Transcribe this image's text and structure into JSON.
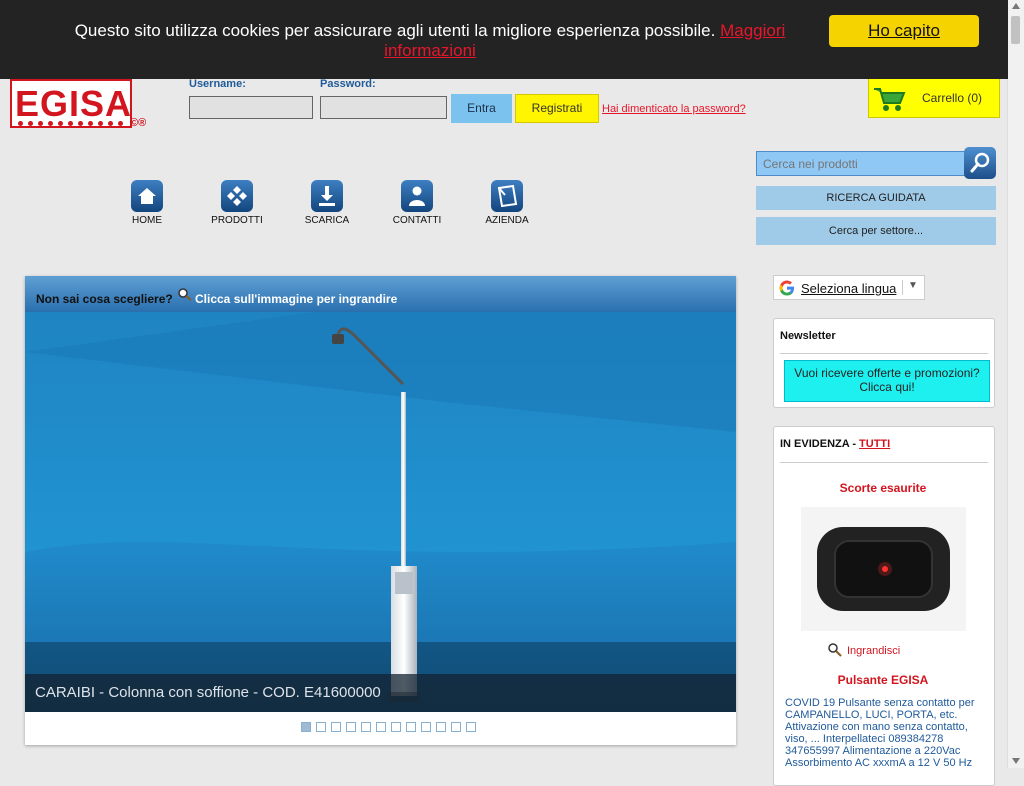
{
  "cookie": {
    "text": "Questo sito utilizza cookies per assicurare agli utenti la migliore esperienza possibile.",
    "link": "Maggiori informazioni",
    "button": "Ho capito"
  },
  "logo": {
    "text": "EGISA",
    "mark": "©®"
  },
  "login": {
    "username_label": "Username:",
    "password_label": "Password:",
    "login_button": "Entra",
    "register_button": "Registrati",
    "forgot_link": "Hai dimenticato la password?"
  },
  "cart": {
    "label": "Carrello (0)"
  },
  "search": {
    "placeholder": "Cerca nei prodotti"
  },
  "buttons": {
    "guided_search": "RICERCA GUIDATA",
    "sector_search": "Cerca per settore..."
  },
  "nav": [
    {
      "label": "HOME",
      "icon": "home-icon"
    },
    {
      "label": "PRODOTTI",
      "icon": "products-icon"
    },
    {
      "label": "SCARICA",
      "icon": "download-icon"
    },
    {
      "label": "CONTATTI",
      "icon": "contact-icon"
    },
    {
      "label": "AZIENDA",
      "icon": "company-icon"
    }
  ],
  "slider": {
    "title": "Non sai cosa scegliere?",
    "hint": "Clicca sull'immagine per ingrandire",
    "caption": "CARAIBI - Colonna con soffione - COD. E41600000",
    "slide_count": 12,
    "active_slide": 1
  },
  "language": {
    "label": "Seleziona lingua",
    "arrow": "▼"
  },
  "newsletter": {
    "title": "Newsletter",
    "button": "Vuoi ricevere offerte e promozioni? Clicca qui!"
  },
  "featured": {
    "title": "IN EVIDENZA - ",
    "all_link": "TUTTI",
    "status": "Scorte esaurite",
    "zoom_label": "Ingrandisci",
    "product_name": "Pulsante EGISA",
    "description": "COVID 19 Pulsante senza contatto per CAMPANELLO, LUCI, PORTA, etc. Attivazione con mano senza contatto, viso, ... Interpellateci 089384278 347655997 Alimentazione a 220Vac Assorbimento AC xxxmA a 12 V 50 Hz"
  },
  "colors": {
    "brand_red": "#d2151e",
    "cookie_bg": "#232323",
    "cookie_button": "#f4d300",
    "cart_bg": "#ffff00",
    "nav_blue": "#1d4f8a",
    "newsletter_cyan": "#1ef0f0"
  }
}
